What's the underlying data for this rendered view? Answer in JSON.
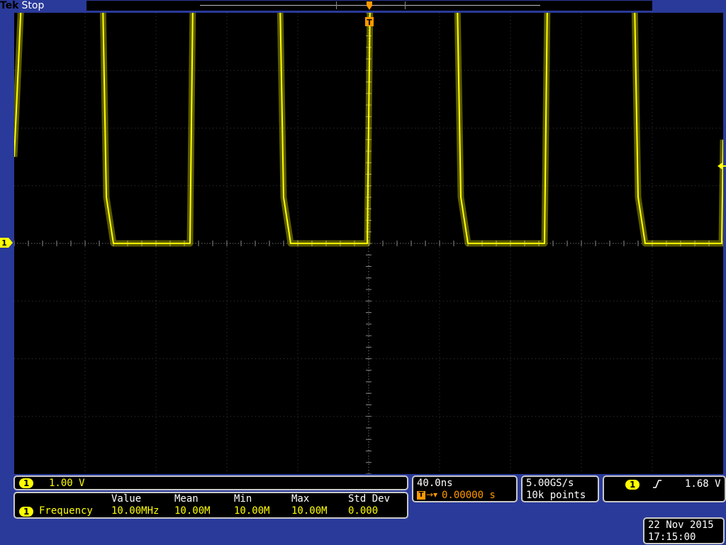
{
  "header": {
    "brand": "Tek",
    "run_state": "Stop"
  },
  "channel": {
    "number": "1",
    "scale": "1.00 V"
  },
  "timebase": {
    "scale": "40.0ns",
    "trigger_position": "0.00000 s",
    "trigger_marker": "T"
  },
  "acquisition": {
    "sample_rate": "5.00GS/s",
    "record_length": "10k points"
  },
  "trigger": {
    "source": "1",
    "level": "1.68 V"
  },
  "measurements": {
    "columns": [
      "Value",
      "Mean",
      "Min",
      "Max",
      "Std Dev"
    ],
    "rows": [
      {
        "source": "1",
        "name": "Frequency",
        "values": [
          "10.00MHz",
          "10.00M",
          "10.00M",
          "10.00M",
          "0.000"
        ]
      }
    ]
  },
  "datetime": {
    "date": "22 Nov 2015",
    "time": "17:15:00"
  },
  "colors": {
    "trace": "#ffff00",
    "trigger": "#ff9900",
    "frame": "#2a3a9a"
  },
  "chart_data": {
    "type": "line",
    "series": [
      {
        "x_div": [
          0,
          0.1,
          0.3,
          1.25,
          1.3,
          1.4,
          2.48,
          2.52,
          2.6,
          3.75,
          3.8,
          3.9,
          4.98,
          5.02,
          5.1,
          6.25,
          6.3,
          6.4,
          7.48,
          7.52,
          7.6,
          8.75,
          8.8,
          8.9,
          9.98,
          10
        ],
        "y_div": [
          1.5,
          4.2,
          4.2,
          4.2,
          0.8,
          0,
          0,
          4.2,
          4.2,
          4.2,
          0.8,
          0,
          0,
          4.2,
          4.2,
          4.2,
          0.8,
          0,
          0,
          4.2,
          4.2,
          4.2,
          0.8,
          0,
          0,
          1.8
        ]
      }
    ],
    "xlim": [
      0,
      10
    ],
    "ylim": [
      -4,
      4
    ],
    "grid": true
  }
}
